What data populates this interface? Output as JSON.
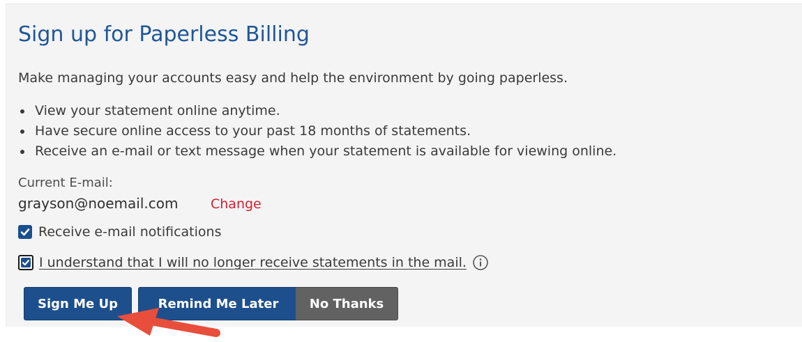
{
  "title": "Sign up for Paperless Billing",
  "intro": "Make managing your accounts easy and help the environment by going paperless.",
  "benefits": [
    "View your statement online anytime.",
    "Have secure online access to your past 18 months of statements.",
    "Receive an e-mail or text message when your statement is available for viewing online."
  ],
  "email": {
    "label": "Current E-mail:",
    "value": "grayson@noemail.com",
    "change_link": "Change"
  },
  "options": {
    "receive_notifications": {
      "label": "Receive e-mail notifications",
      "checked": true
    },
    "no_mail_acknowledgement": {
      "label": "I understand that I will no longer receive statements in the mail.",
      "checked": true,
      "info_icon": "info-circle-icon"
    }
  },
  "buttons": {
    "sign_up": "Sign Me Up",
    "remind_later": "Remind Me Later",
    "no_thanks": "No Thanks"
  },
  "colors": {
    "heading": "#1f5796",
    "primary_button": "#1d4f8d",
    "secondary_button": "#626262",
    "change_link": "#d21f2e",
    "annotation_arrow": "#e84e3c"
  }
}
